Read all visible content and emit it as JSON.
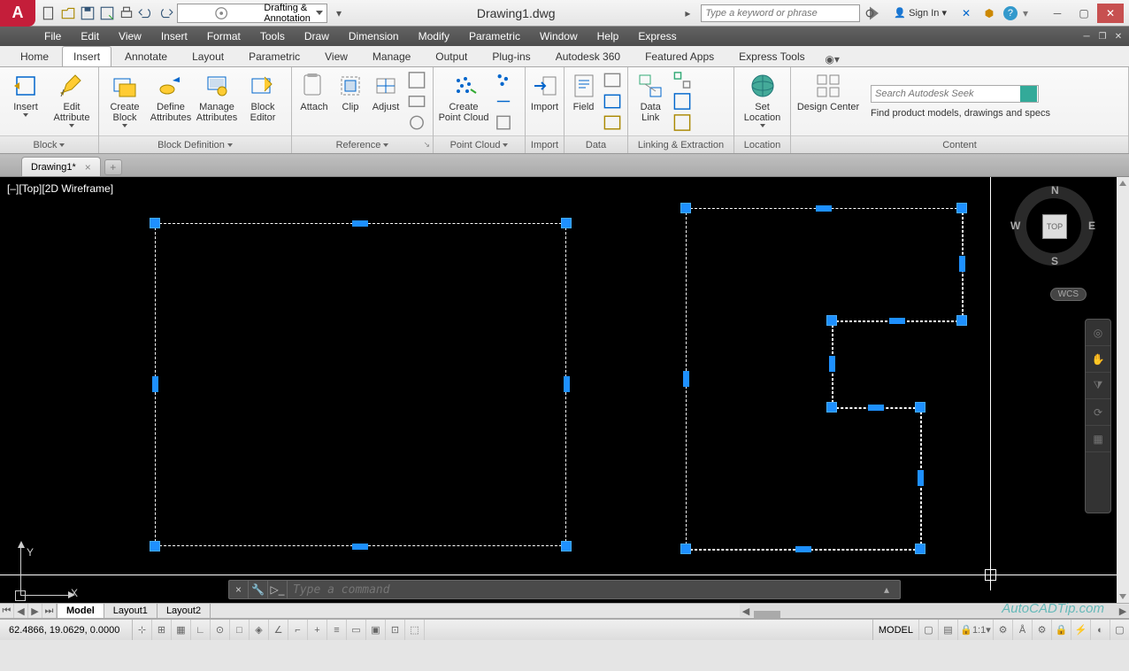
{
  "title": "Drawing1.dwg",
  "app_logo": "A",
  "workspace": "Drafting & Annotation",
  "search_placeholder": "Type a keyword or phrase",
  "signin": "Sign In",
  "menus": [
    "File",
    "Edit",
    "View",
    "Insert",
    "Format",
    "Tools",
    "Draw",
    "Dimension",
    "Modify",
    "Parametric",
    "Window",
    "Help",
    "Express"
  ],
  "ribbon_tabs": [
    "Home",
    "Insert",
    "Annotate",
    "Layout",
    "Parametric",
    "View",
    "Manage",
    "Output",
    "Plug-ins",
    "Autodesk 360",
    "Featured Apps",
    "Express Tools"
  ],
  "active_ribbon_tab": 1,
  "panels": {
    "block": {
      "title": "Block",
      "btns": [
        {
          "l": "Insert"
        },
        {
          "l": "Edit\nAttribute"
        }
      ]
    },
    "blockdef": {
      "title": "Block Definition",
      "btns": [
        {
          "l": "Create\nBlock"
        },
        {
          "l": "Define\nAttributes"
        },
        {
          "l": "Manage\nAttributes"
        },
        {
          "l": "Block\nEditor"
        }
      ]
    },
    "reference": {
      "title": "Reference",
      "btns": [
        {
          "l": "Attach"
        },
        {
          "l": "Clip"
        },
        {
          "l": "Adjust"
        }
      ]
    },
    "pointcloud": {
      "title": "Point Cloud",
      "btns": [
        {
          "l": "Create\nPoint Cloud"
        }
      ]
    },
    "import": {
      "title": "Import",
      "btns": [
        {
          "l": "Import"
        }
      ]
    },
    "data": {
      "title": "Data",
      "btns": [
        {
          "l": "Field"
        }
      ]
    },
    "linking": {
      "title": "Linking & Extraction",
      "btns": [
        {
          "l": "Data\nLink"
        }
      ]
    },
    "location": {
      "title": "Location",
      "btns": [
        {
          "l": "Set\nLocation"
        }
      ]
    },
    "content": {
      "title": "Content",
      "btns": [
        {
          "l": "Design Center"
        }
      ],
      "seek_placeholder": "Search Autodesk Seek",
      "seek_text": "Find product models, drawings and specs"
    }
  },
  "file_tab": "Drawing1*",
  "viewport_label": "[–][Top][2D Wireframe]",
  "viewcube": {
    "top": "TOP",
    "n": "N",
    "s": "S",
    "e": "E",
    "w": "W"
  },
  "wcs": "WCS",
  "ucs": {
    "x": "X",
    "y": "Y"
  },
  "command_placeholder": "Type a command",
  "layout_tabs": [
    "Model",
    "Layout1",
    "Layout2"
  ],
  "active_layout": 0,
  "coords": "62.4866, 19.0629, 0.0000",
  "model_indicator": "MODEL",
  "scale": "1:1",
  "watermark": "AutoCADTip.com"
}
